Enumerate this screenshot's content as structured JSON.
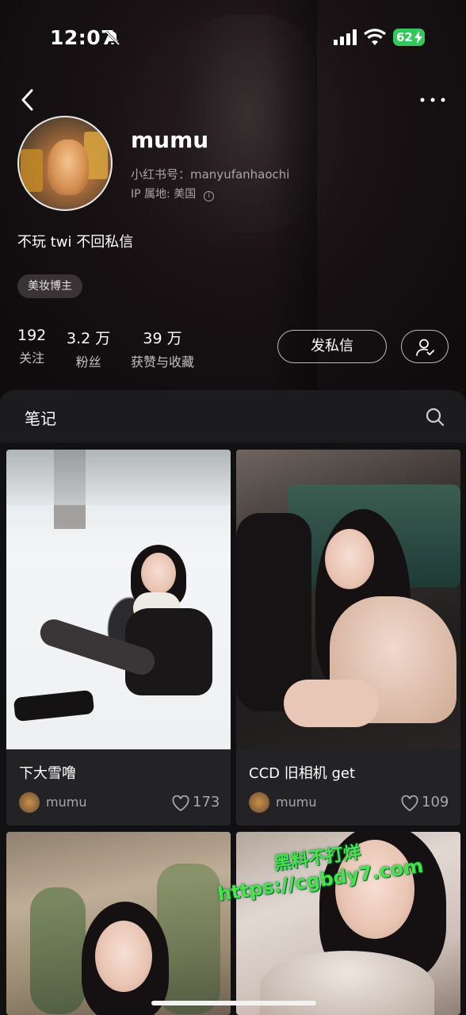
{
  "status": {
    "time": "12:07",
    "battery": "62"
  },
  "profile": {
    "username": "mumu",
    "red_id": "小红书号：manyufanhaochi",
    "ip": "IP 属地: 美国",
    "bio": "不玩 twi 不回私信",
    "tag": "美妆博主"
  },
  "stats": [
    {
      "num": "192",
      "label": "关注"
    },
    {
      "num": "3.2 万",
      "label": "粉丝"
    },
    {
      "num": "39 万",
      "label": "获赞与收藏"
    }
  ],
  "actions": {
    "message": "发私信"
  },
  "notes": {
    "title": "笔记",
    "cards": [
      {
        "title": "下大雪噜",
        "author": "mumu",
        "likes": "173"
      },
      {
        "title": "CCD 旧相机 get",
        "author": "mumu",
        "likes": "109"
      }
    ]
  },
  "watermark": {
    "line1": "黑料不打烊",
    "line2": "https://cgbdy7.com"
  },
  "icons": [
    "bell-off-icon",
    "signal-icon",
    "wifi-icon",
    "back-icon",
    "more-icon",
    "follow-check-icon",
    "search-icon",
    "heart-icon"
  ]
}
